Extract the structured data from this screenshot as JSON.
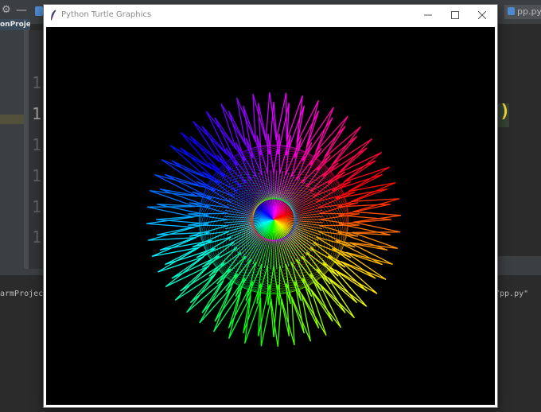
{
  "ide": {
    "project_label": "onProjec",
    "line_numbers": [
      "1",
      "1",
      "1",
      "1",
      "1",
      "1"
    ],
    "run_text_left": "armProject",
    "run_text_right": "/pp.py\"",
    "right_tab_label": "pp.py",
    "paren": ")"
  },
  "window": {
    "title": "Python Turtle Graphics",
    "controls": [
      "minimize-icon",
      "maximize-icon",
      "close-icon"
    ]
  },
  "canvas": {
    "background": "#000000",
    "figure": "rainbow-spirograph"
  }
}
